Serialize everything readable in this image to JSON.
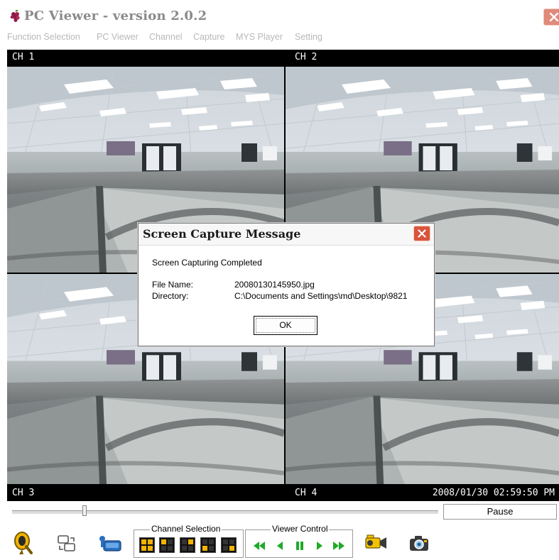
{
  "window": {
    "title": "PC Viewer  - version 2.0.2",
    "app_icon": "grape-cluster-icon",
    "close_icon": "close-icon"
  },
  "menu": {
    "items": [
      {
        "label": "Function Selection"
      },
      {
        "label": "PC Viewer"
      },
      {
        "label": "Channel"
      },
      {
        "label": "Capture"
      },
      {
        "label": "MYS Player"
      },
      {
        "label": "Setting"
      }
    ]
  },
  "channels": {
    "ch1": "CH 1",
    "ch2": "CH 2",
    "ch3": "CH 3",
    "ch4": "CH 4",
    "timestamp": "2008/01/30 02:59:50 PM"
  },
  "dialog": {
    "title": "Screen Capture Message",
    "message": "Screen Capturing Completed",
    "file_name_label": "File Name:",
    "file_name_value": "20080130145950.jpg",
    "directory_label": "Directory:",
    "directory_value": "C:\\Documents and Settings\\md\\Desktop\\9821",
    "ok_label": "OK"
  },
  "playback": {
    "position_fraction": 0.17,
    "status": "Pause"
  },
  "toolbar": {
    "channel_selection_label": "Channel Selection",
    "viewer_control_label": "Viewer Control",
    "tools": [
      "search-icon",
      "swap-windows-icon",
      "info-icon",
      "record-icon",
      "snapshot-camera-icon"
    ],
    "channel_layouts": [
      "quad-layout-icon",
      "single-ch1-icon",
      "single-ch2-icon",
      "single-ch3-icon",
      "single-ch4-icon"
    ],
    "viewer_controls": [
      "fast-rewind-icon",
      "rewind-icon",
      "pause-icon",
      "play-icon",
      "fast-forward-icon"
    ]
  },
  "colors": {
    "accent_yellow": "#f2b400",
    "control_green": "#1faa2a",
    "close_red": "#d9553b"
  }
}
